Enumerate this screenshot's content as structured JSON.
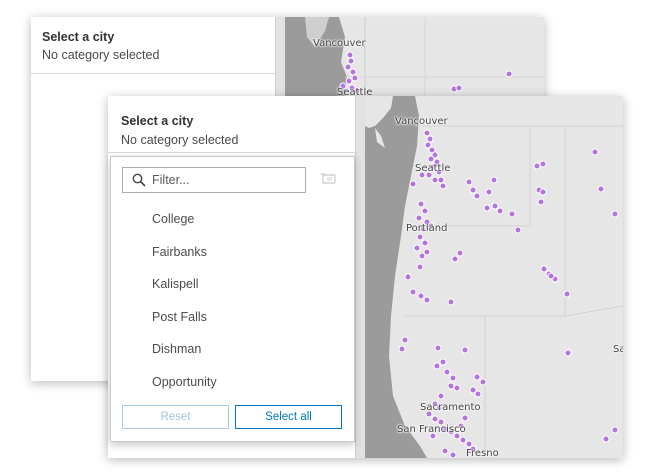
{
  "back_window": {
    "panel_title": "Select a city",
    "panel_subtitle": "No category selected",
    "map_labels": [
      "Vancouver",
      "Seattle"
    ]
  },
  "front_window": {
    "panel_title": "Select a city",
    "panel_subtitle": "No category selected",
    "map_labels": [
      "Vancouver",
      "Seattle",
      "Portland",
      "Sacramento",
      "San Francisco",
      "Fresno",
      "Sa"
    ]
  },
  "dropdown": {
    "filter_placeholder": "Filter...",
    "filter_value": "",
    "items": [
      "College",
      "Fairbanks",
      "Kalispell",
      "Post Falls",
      "Dishman",
      "Opportunity"
    ],
    "reset_label": "Reset",
    "select_all_label": "Select all"
  },
  "colors": {
    "point": "#b573e0",
    "accent": "#0079c1",
    "land": "#e6e6e6",
    "water": "#9b9b9b"
  }
}
